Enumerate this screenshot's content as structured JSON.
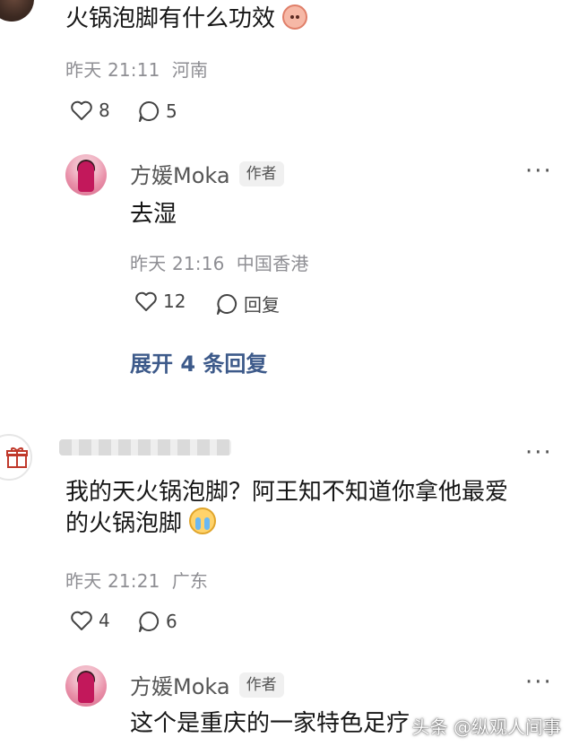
{
  "comment1": {
    "text": "火锅泡脚有什么功效",
    "emoji": "pig-face-emoji",
    "time": "昨天 21:11",
    "location": "河南",
    "likes": "8",
    "replies": "5"
  },
  "reply1": {
    "name": "方媛Moka",
    "tag": "作者",
    "text": "去湿",
    "time": "昨天 21:16",
    "location": "中国香港",
    "likes": "12",
    "reply_label": "回复"
  },
  "expand": {
    "label": "展开 4 条回复"
  },
  "comment2": {
    "text_line1": "我的天火锅泡脚？阿王知不知道你拿他最爱",
    "text_line2": "的火锅泡脚",
    "emoji": "crying-emoji",
    "time": "昨天 21:21",
    "location": "广东",
    "likes": "4",
    "replies": "6"
  },
  "reply2": {
    "name": "方媛Moka",
    "tag": "作者",
    "text": "这个是重庆的一家特色足疗"
  },
  "watermark": "头条 @纵观人间事",
  "more_glyph": "···",
  "colors": {
    "link": "#3d5a8a",
    "meta": "#8e8e93"
  }
}
